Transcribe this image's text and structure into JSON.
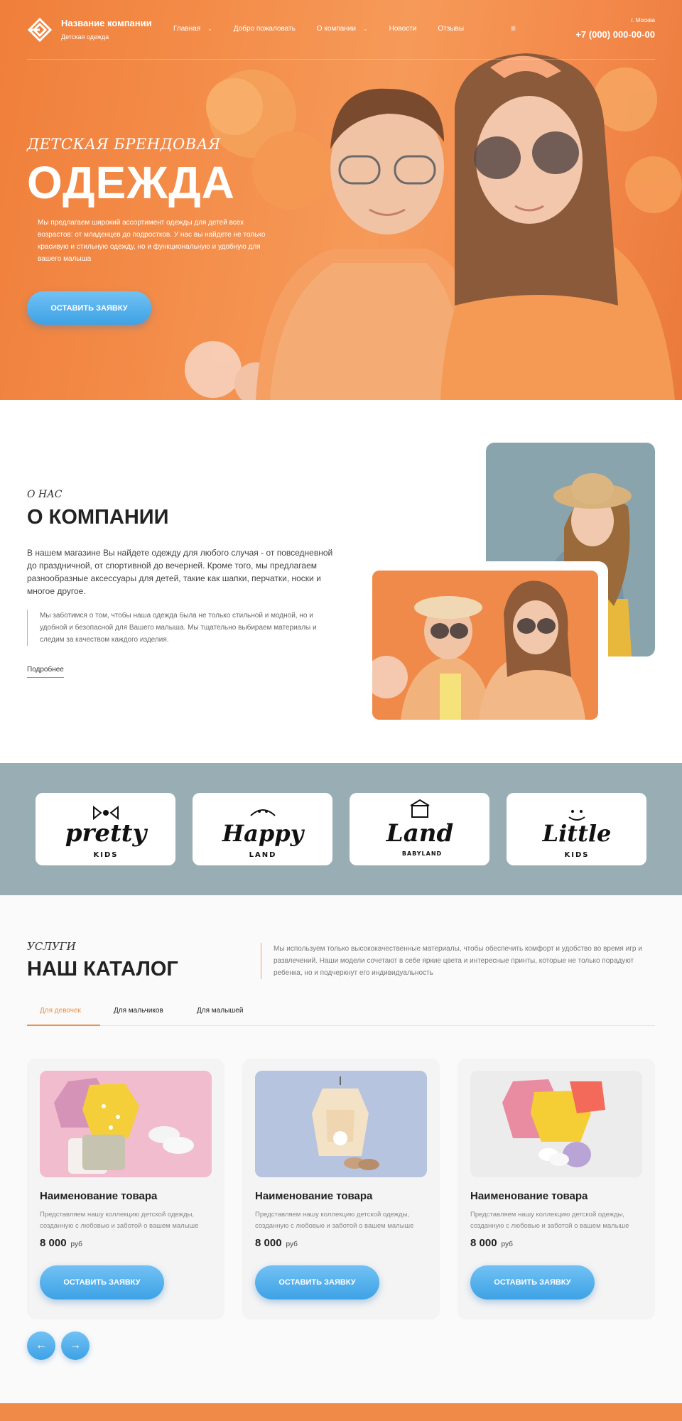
{
  "header": {
    "brand_name": "Название компании",
    "brand_sub": "Детская одежда",
    "nav": [
      {
        "label": "Главная",
        "has_dropdown": true
      },
      {
        "label": "Добро пожаловать",
        "has_dropdown": false
      },
      {
        "label": "О компании",
        "has_dropdown": true
      },
      {
        "label": "Новости",
        "has_dropdown": false
      },
      {
        "label": "Отзывы",
        "has_dropdown": false
      }
    ],
    "burger_icon": "≡",
    "city": "г. Москва",
    "phone": "+7 (000) 000-00-00"
  },
  "hero": {
    "kicker": "ДЕТСКАЯ БРЕНДОВАЯ",
    "title": "ОДЕЖДА",
    "text": "Мы предлагаем широкий ассортимент одежды для детей всех возрастов: от младенцев до подростков. У нас вы найдете не только красивую и стильную одежду, но и функциональную и удобную для вашего малыша",
    "button": "ОСТАВИТЬ ЗАЯВКУ"
  },
  "about": {
    "kicker": "О НАС",
    "title": "О КОМПАНИИ",
    "paragraph": "В нашем магазине Вы найдете одежду для любого случая - от повседневной до праздничной, от спортивной до вечерней. Кроме того, мы предлагаем разнообразные аксессуары для детей, такие как шапки, перчатки, носки и многое другое.",
    "quote": "Мы заботимся о том, чтобы наша одежда была не только стильной и модной, но и удобной и безопасной для Вашего малыша. Мы тщательно выбираем материалы и следим за качеством каждого изделия.",
    "link": "Подробнее"
  },
  "brands": [
    {
      "name": "pretty",
      "sub": "KIDS"
    },
    {
      "name": "Happy",
      "sub": "LAND"
    },
    {
      "name": "Land",
      "sub": "BABYLAND"
    },
    {
      "name": "Little",
      "sub": "KIDS"
    }
  ],
  "catalog": {
    "kicker": "УСЛУГИ",
    "title": "НАШ КАТАЛОГ",
    "description": "Мы используем только высококачественные материалы, чтобы обеспечить комфорт и удобство во время игр и развлечений. Наши модели сочетают в себе яркие цвета и интересные принты, которые не только порадуют ребенка, но и подчеркнут его индивидуальность",
    "tabs": [
      "Для девочек",
      "Для мальчиков",
      "Для малышей"
    ],
    "active_tab": 0,
    "products": [
      {
        "title": "Наименование товара",
        "desc": "Представляем нашу коллекцию детской одежды, созданную с любовью и заботой о вашем малыше",
        "price": "8 000",
        "currency": "руб",
        "button": "ОСТАВИТЬ ЗАЯВКУ",
        "bg": "#f3bfd0"
      },
      {
        "title": "Наименование товара",
        "desc": "Представляем нашу коллекцию детской одежды, созданную с любовью и заботой о вашем малыше",
        "price": "8 000",
        "currency": "руб",
        "button": "ОСТАВИТЬ ЗАЯВКУ",
        "bg": "#b8c6e2"
      },
      {
        "title": "Наименование товара",
        "desc": "Представляем нашу коллекцию детской одежды, созданную с любовью и заботой о вашем малыше",
        "price": "8 000",
        "currency": "руб",
        "button": "ОСТАВИТЬ ЗАЯВКУ",
        "bg": "#ececec"
      }
    ],
    "prev_icon": "←",
    "next_icon": "→"
  },
  "colors": {
    "accent_orange": "#ef8a48",
    "accent_blue": "#3da2e5",
    "brand_strip": "#99adb5"
  }
}
